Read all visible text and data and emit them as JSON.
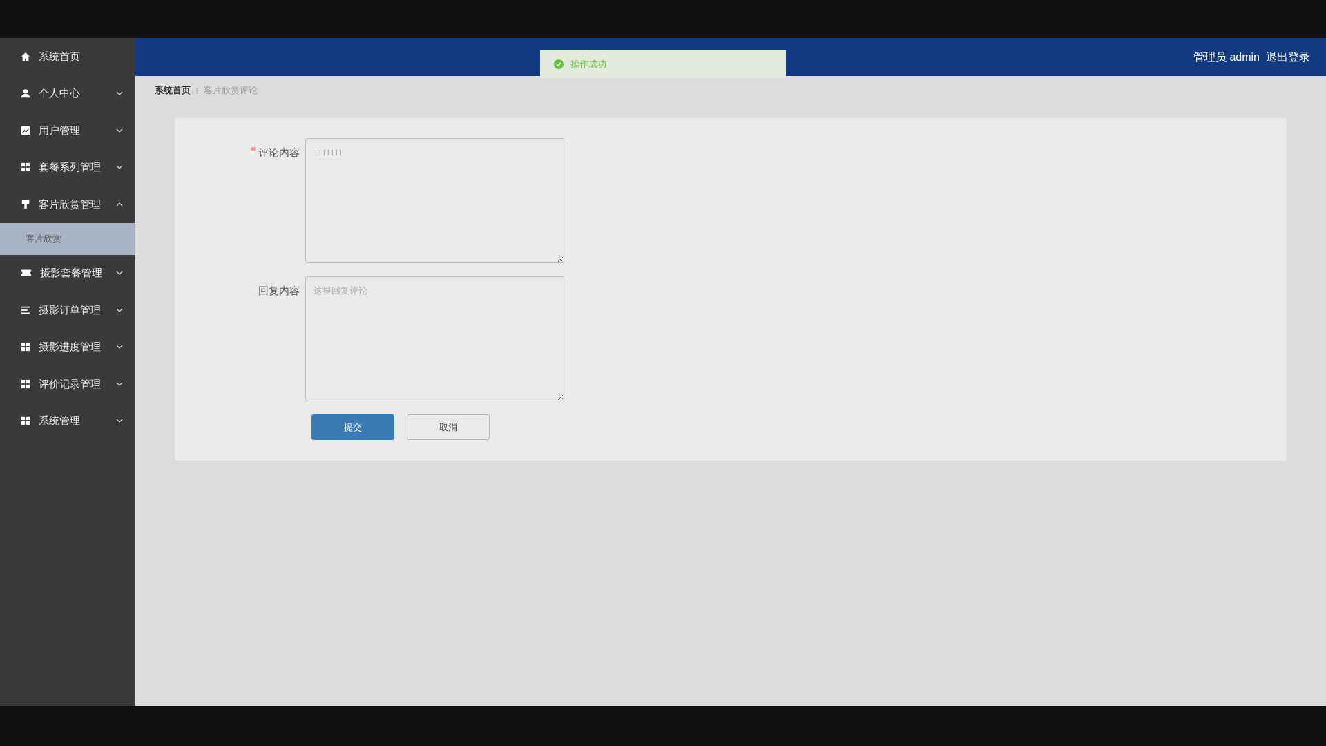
{
  "sidebar": {
    "items": [
      {
        "label": "系统首页",
        "kind": "link"
      },
      {
        "label": "个人中心",
        "kind": "submenu",
        "expanded": false
      },
      {
        "label": "用户管理",
        "kind": "submenu",
        "expanded": false
      },
      {
        "label": "套餐系列管理",
        "kind": "submenu",
        "expanded": false
      },
      {
        "label": "客片欣赏管理",
        "kind": "submenu",
        "expanded": true,
        "children": [
          {
            "label": "客片欣赏",
            "selected": true
          }
        ]
      },
      {
        "label": "摄影套餐管理",
        "kind": "submenu",
        "expanded": false
      },
      {
        "label": "摄影订单管理",
        "kind": "submenu",
        "expanded": false
      },
      {
        "label": "摄影进度管理",
        "kind": "submenu",
        "expanded": false
      },
      {
        "label": "评价记录管理",
        "kind": "submenu",
        "expanded": false
      },
      {
        "label": "系统管理",
        "kind": "submenu",
        "expanded": false
      }
    ]
  },
  "header": {
    "user": "管理员 admin",
    "logout": "退出登录"
  },
  "toast": {
    "kind": "success",
    "message": "操作成功"
  },
  "breadcrumb": [
    "系统首页",
    "客片欣赏评论"
  ],
  "form": {
    "fields": [
      {
        "label": "评论内容",
        "required": true,
        "placeholder": "1111111"
      },
      {
        "label": "回复内容",
        "required": false,
        "placeholder": "这里回复评论"
      }
    ],
    "buttons": [
      {
        "label": "提交",
        "kind": "primary"
      },
      {
        "label": "取消",
        "kind": "default"
      }
    ]
  }
}
